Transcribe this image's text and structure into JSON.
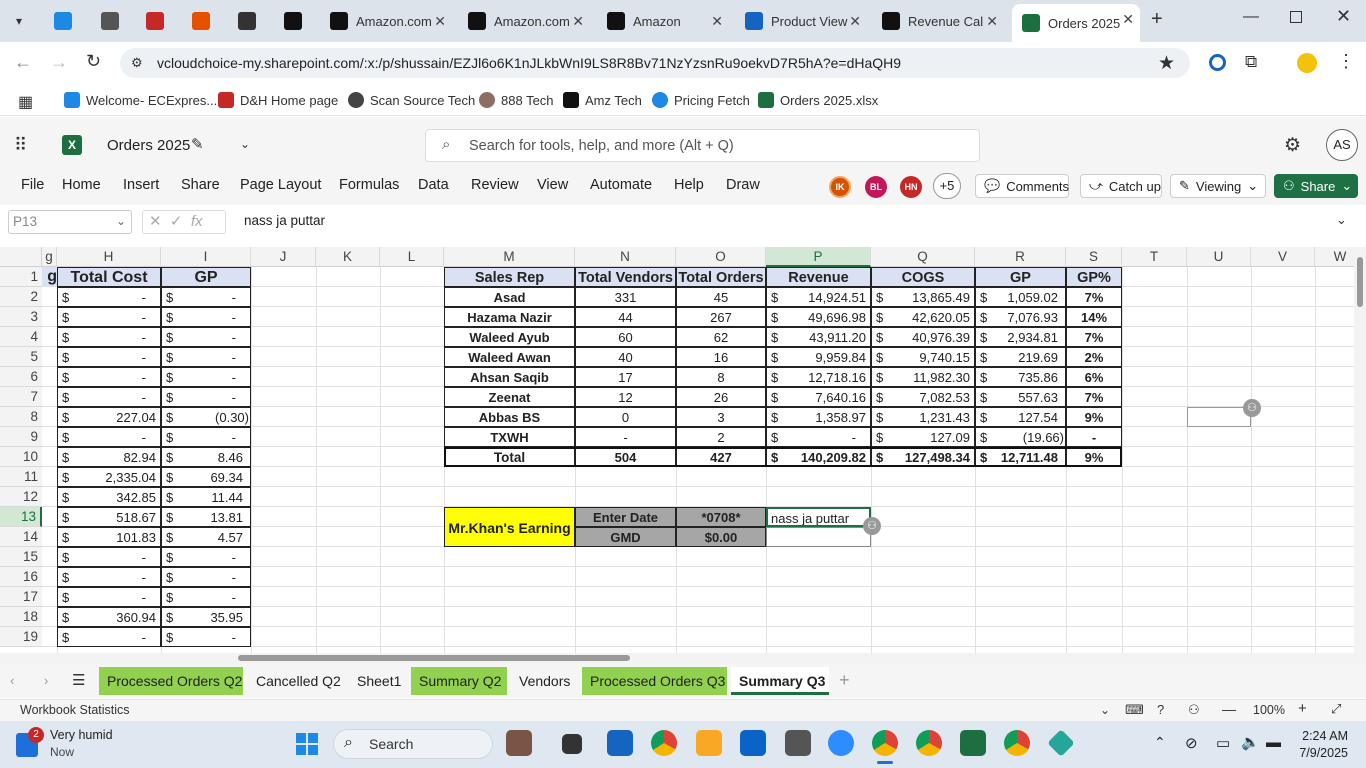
{
  "browser": {
    "tabs": [
      {
        "label": "",
        "icon": "ec-icon",
        "color": "#1e88e5"
      },
      {
        "label": "",
        "icon": "globe-icon",
        "color": "#555555"
      },
      {
        "label": "",
        "icon": "dh-icon",
        "color": "#c62828"
      },
      {
        "label": "",
        "icon": "s-icon",
        "color": "#e65100"
      },
      {
        "label": "",
        "icon": "888-icon",
        "color": "#333333"
      },
      {
        "label": "",
        "icon": "amz-icon",
        "color": "#111111"
      },
      {
        "label": "Amazon.com",
        "icon": "amazon-icon",
        "color": "#111111"
      },
      {
        "label": "Amazon.com",
        "icon": "amazon-icon",
        "color": "#111111"
      },
      {
        "label": "Amazon",
        "icon": "amz-icon",
        "color": "#111111"
      },
      {
        "label": "Product View",
        "icon": "product-icon",
        "color": "#1565c0"
      },
      {
        "label": "Revenue Cal",
        "icon": "amz-icon",
        "color": "#111111"
      },
      {
        "label": "Orders 2025",
        "icon": "excel-icon",
        "color": "#1d6f42"
      }
    ],
    "url": "vcloudchoice-my.sharepoint.com/:x:/p/shussain/EZJl6o6K1nJLkbWnI9LS8R8Bv71NzYzsnRu9oekvD7R5hA?e=dHaQH9",
    "bookmarks": [
      "Welcome- ECExpres...",
      "D&H Home page",
      "Scan Source Tech",
      "888 Tech",
      "Amz Tech",
      "Pricing Fetch",
      "Orders 2025.xlsx"
    ]
  },
  "excel": {
    "doc_title": "Orders 2025",
    "search_placeholder": "Search for tools, help, and more (Alt + Q)",
    "user_initials": "AS",
    "menu": [
      "File",
      "Home",
      "Insert",
      "Share",
      "Page Layout",
      "Formulas",
      "Data",
      "Review",
      "View",
      "Automate",
      "Help",
      "Draw"
    ],
    "collaborators": [
      {
        "initials": "IK",
        "color": "#d35400"
      },
      {
        "initials": "BL",
        "color": "#c2185b"
      },
      {
        "initials": "HN",
        "color": "#c62828"
      }
    ],
    "more_collaborators": "+5",
    "comments_label": "Comments",
    "catchup_label": "Catch up",
    "viewing_label": "Viewing",
    "share_label": "Share",
    "name_box": "P13",
    "formula_value": "nass ja puttar",
    "columns": [
      "g",
      "H",
      "I",
      "J",
      "K",
      "L",
      "M",
      "N",
      "O",
      "P",
      "Q",
      "R",
      "S",
      "T",
      "U",
      "V",
      "W"
    ],
    "rows": [
      "1",
      "2",
      "3",
      "4",
      "5",
      "6",
      "7",
      "8",
      "9",
      "10",
      "11",
      "12",
      "13",
      "14",
      "15",
      "16",
      "17",
      "18",
      "19"
    ],
    "left_headers": {
      "g": "g",
      "total_cost": "Total Cost",
      "gp": "GP"
    },
    "left_rows": [
      {
        "cost": "-",
        "gp": "-"
      },
      {
        "cost": "-",
        "gp": "-"
      },
      {
        "cost": "-",
        "gp": "-"
      },
      {
        "cost": "-",
        "gp": "-"
      },
      {
        "cost": "-",
        "gp": "-"
      },
      {
        "cost": "-",
        "gp": "-"
      },
      {
        "cost": "227.04",
        "gp": "(0.30)"
      },
      {
        "cost": "-",
        "gp": "-"
      },
      {
        "cost": "82.94",
        "gp": "8.46"
      },
      {
        "cost": "2,335.04",
        "gp": "69.34"
      },
      {
        "cost": "342.85",
        "gp": "11.44"
      },
      {
        "cost": "518.67",
        "gp": "13.81"
      },
      {
        "cost": "101.83",
        "gp": "4.57"
      },
      {
        "cost": "-",
        "gp": "-"
      },
      {
        "cost": "-",
        "gp": "-"
      },
      {
        "cost": "-",
        "gp": "-"
      },
      {
        "cost": "360.94",
        "gp": "35.95"
      },
      {
        "cost": "-",
        "gp": "-"
      }
    ],
    "currency": "$",
    "summary_headers": [
      "Sales Rep",
      "Total Vendors",
      "Total Orders",
      "Revenue",
      "COGS",
      "GP",
      "GP%"
    ],
    "summary_rows": [
      {
        "rep": "Asad",
        "vendors": "331",
        "orders": "45",
        "revenue": "14,924.51",
        "cogs": "13,865.49",
        "gp": "1,059.02",
        "gpp": "7%"
      },
      {
        "rep": "Hazama Nazir",
        "vendors": "44",
        "orders": "267",
        "revenue": "49,696.98",
        "cogs": "42,620.05",
        "gp": "7,076.93",
        "gpp": "14%"
      },
      {
        "rep": "Waleed Ayub",
        "vendors": "60",
        "orders": "62",
        "revenue": "43,911.20",
        "cogs": "40,976.39",
        "gp": "2,934.81",
        "gpp": "7%"
      },
      {
        "rep": "Waleed Awan",
        "vendors": "40",
        "orders": "16",
        "revenue": "9,959.84",
        "cogs": "9,740.15",
        "gp": "219.69",
        "gpp": "2%"
      },
      {
        "rep": "Ahsan Saqib",
        "vendors": "17",
        "orders": "8",
        "revenue": "12,718.16",
        "cogs": "11,982.30",
        "gp": "735.86",
        "gpp": "6%"
      },
      {
        "rep": "Zeenat",
        "vendors": "12",
        "orders": "26",
        "revenue": "7,640.16",
        "cogs": "7,082.53",
        "gp": "557.63",
        "gpp": "7%"
      },
      {
        "rep": "Abbas BS",
        "vendors": "0",
        "orders": "3",
        "revenue": "1,358.97",
        "cogs": "1,231.43",
        "gp": "127.54",
        "gpp": "9%"
      },
      {
        "rep": "TXWH",
        "vendors": "-",
        "orders": "2",
        "revenue": "-",
        "cogs": "127.09",
        "gp": "(19.66)",
        "gpp": "-"
      },
      {
        "rep": "Total",
        "vendors": "504",
        "orders": "427",
        "revenue": "140,209.82",
        "cogs": "127,498.34",
        "gp": "12,711.48",
        "gpp": "9%"
      }
    ],
    "earning": {
      "title": "Mr.Khan's Earning",
      "enter_date_label": "Enter Date",
      "enter_date_value": "*0708*",
      "gmd_label": "GMD",
      "gmd_value": "$0.00",
      "p13": "nass ja puttar"
    },
    "sheets": [
      {
        "name": "Processed Orders Q2",
        "color": "#92d050"
      },
      {
        "name": "Cancelled Q2",
        "color": ""
      },
      {
        "name": "Sheet1",
        "color": ""
      },
      {
        "name": "Summary Q2",
        "color": "#92d050"
      },
      {
        "name": "Vendors",
        "color": ""
      },
      {
        "name": "Processed Orders Q3",
        "color": "#92d050"
      },
      {
        "name": "Summary Q3",
        "color": "",
        "active": true
      }
    ],
    "status_left": "Workbook Statistics",
    "zoom": "100%"
  },
  "taskbar": {
    "weather_badge": "2",
    "weather_title": "Very humid",
    "weather_sub": "Now",
    "search_label": "Search",
    "time": "2:24 AM",
    "date": "7/9/2025"
  }
}
